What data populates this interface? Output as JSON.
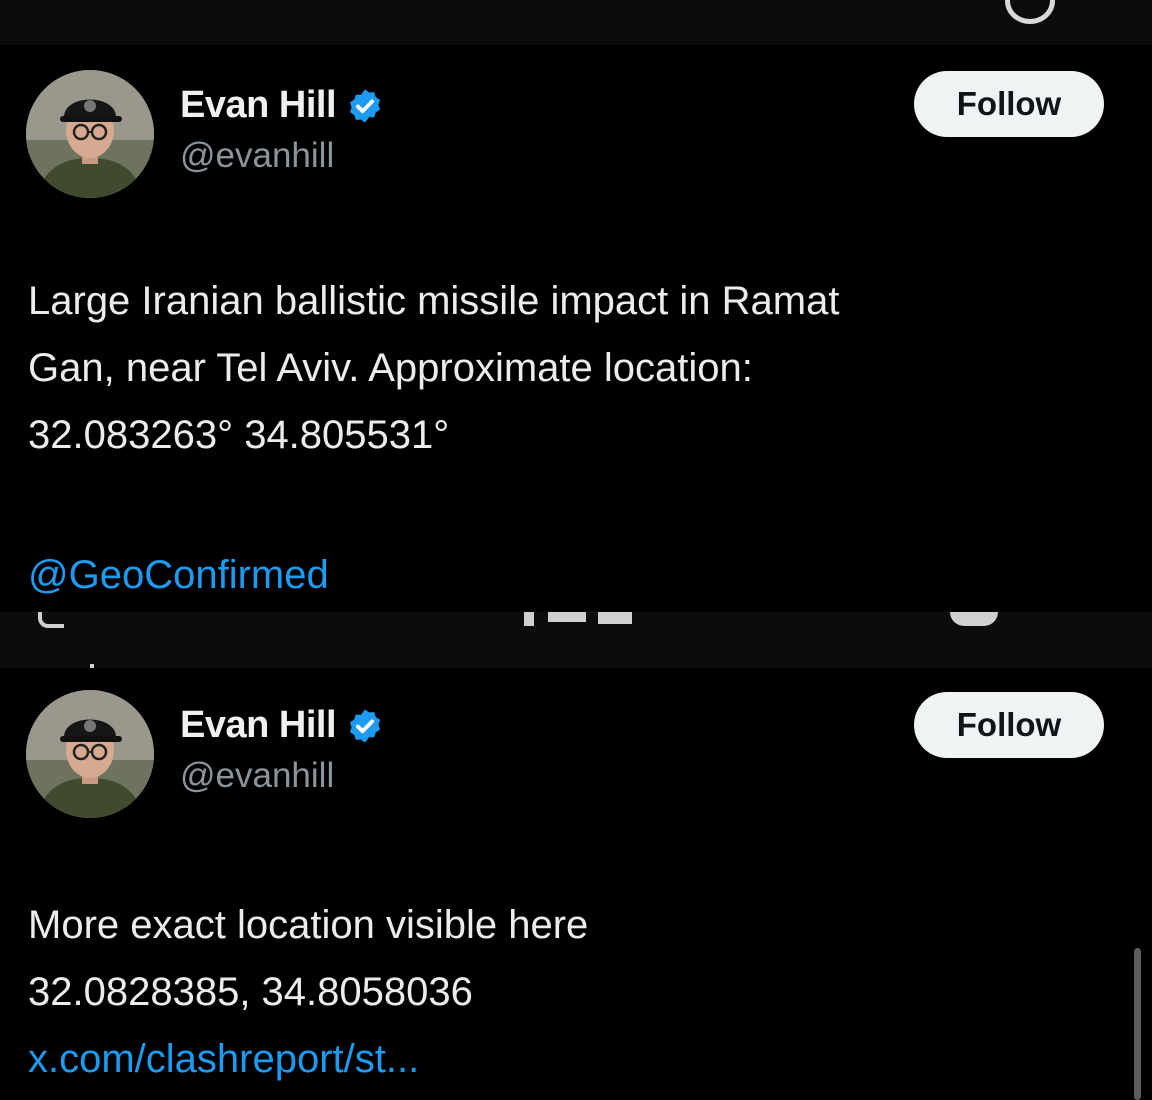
{
  "tweets": [
    {
      "author": {
        "name": "Evan Hill",
        "handle": "@evanhill",
        "verified": true
      },
      "follow_label": "Follow",
      "text_lines": [
        "Large Iranian ballistic missile impact in Ramat",
        "Gan, near Tel Aviv. Approximate location:",
        "32.083263°  34.805531°"
      ],
      "mention": "@GeoConfirmed"
    },
    {
      "author": {
        "name": "Evan Hill",
        "handle": "@evanhill",
        "verified": true
      },
      "follow_label": "Follow",
      "text_lines": [
        "More exact location visible here",
        "32.0828385, 34.8058036"
      ],
      "link": "x.com/clashreport/st..."
    }
  ],
  "colors": {
    "background": "#000000",
    "accent_link": "#1d9bf0",
    "verified_badge": "#1d9bf0",
    "follow_button_bg": "#eff3f4"
  },
  "icons": {
    "verified": "verified-badge-icon"
  }
}
